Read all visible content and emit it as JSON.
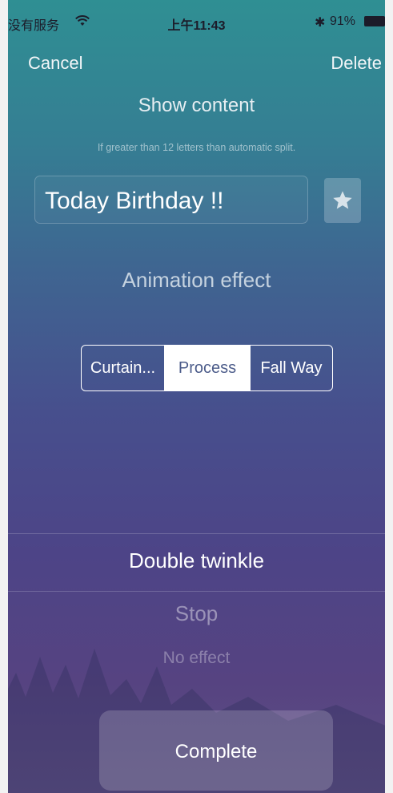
{
  "status_bar": {
    "carrier": "没有服务",
    "time": "上午11:43",
    "battery": "91%",
    "icons": [
      "wifi-icon",
      "bluetooth-icon",
      "battery-icon"
    ]
  },
  "nav": {
    "cancel": "Cancel",
    "delete": "Delete"
  },
  "show_content": {
    "title": "Show content",
    "hint": "If greater than 12 letters than automatic split.",
    "text_value": "Today Birthday !!",
    "star_icon": "star-icon"
  },
  "animation": {
    "title": "Animation effect",
    "segments": [
      "Curtain...",
      "Process",
      "Fall Way"
    ],
    "selected": "Process"
  },
  "picker": {
    "options": [
      "Double twinkle",
      "Stop",
      "No effect"
    ],
    "selected": "Double twinkle"
  },
  "footer": {
    "complete": "Complete"
  },
  "colors": {
    "gradient_top": "#2f8f93",
    "gradient_bottom": "#5f4f83",
    "selected_segment_text": "#4c5c8a"
  }
}
